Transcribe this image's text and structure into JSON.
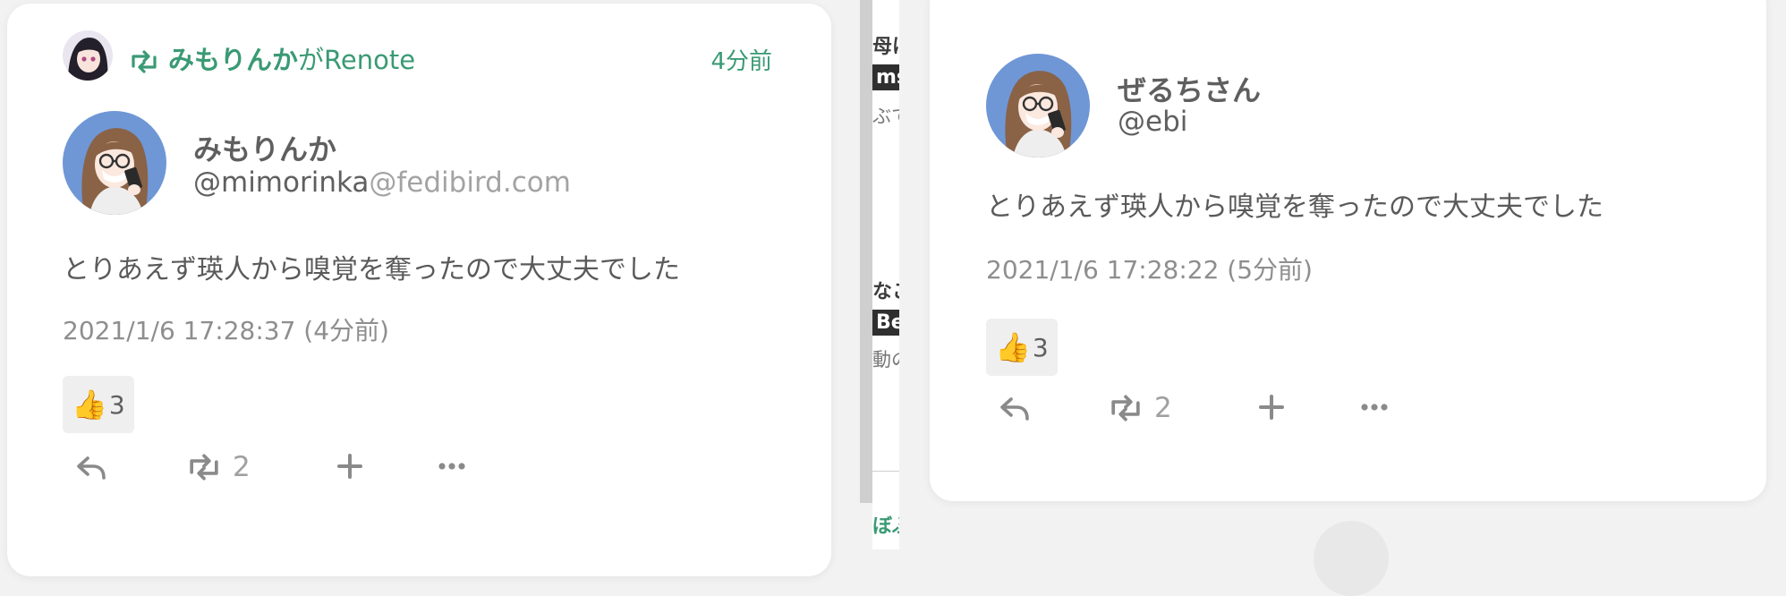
{
  "left_note": {
    "renoter_name": "みもりんか",
    "renote_suffix": "がRenote",
    "renote_time": "4分前",
    "author_name": "みもりんか",
    "author_username": "@mimorinka",
    "author_host": "@fedibird.com",
    "text": "とりあえず瑛人から嗅覚を奪ったので大丈夫でした",
    "datetime": "2021/1/6 17:28:37 (4分前)",
    "reaction_emoji": "👍",
    "reaction_count": "3",
    "renote_count": "2"
  },
  "right_note": {
    "author_name": "ぜるちさん",
    "author_username": "@ebi",
    "text": "とりあえず瑛人から嗅覚を奪ったので大丈夫でした",
    "datetime": "2021/1/6 17:28:22 (5分前)",
    "reaction_emoji": "👍",
    "reaction_count": "3",
    "renote_count": "2"
  },
  "between_fragments": {
    "f1": "母は",
    "f2": "ms",
    "f3": "ぶて",
    "f4": "なこ",
    "f5": "Be",
    "f6": "動の",
    "f7": "ぼぶ"
  },
  "icons": {
    "renote": "renote-icon",
    "reply": "reply-icon",
    "plus": "plus-icon",
    "more": "more-icon"
  },
  "colors": {
    "accent": "#3a9a74",
    "avatar_bg": "#6f97d6"
  }
}
